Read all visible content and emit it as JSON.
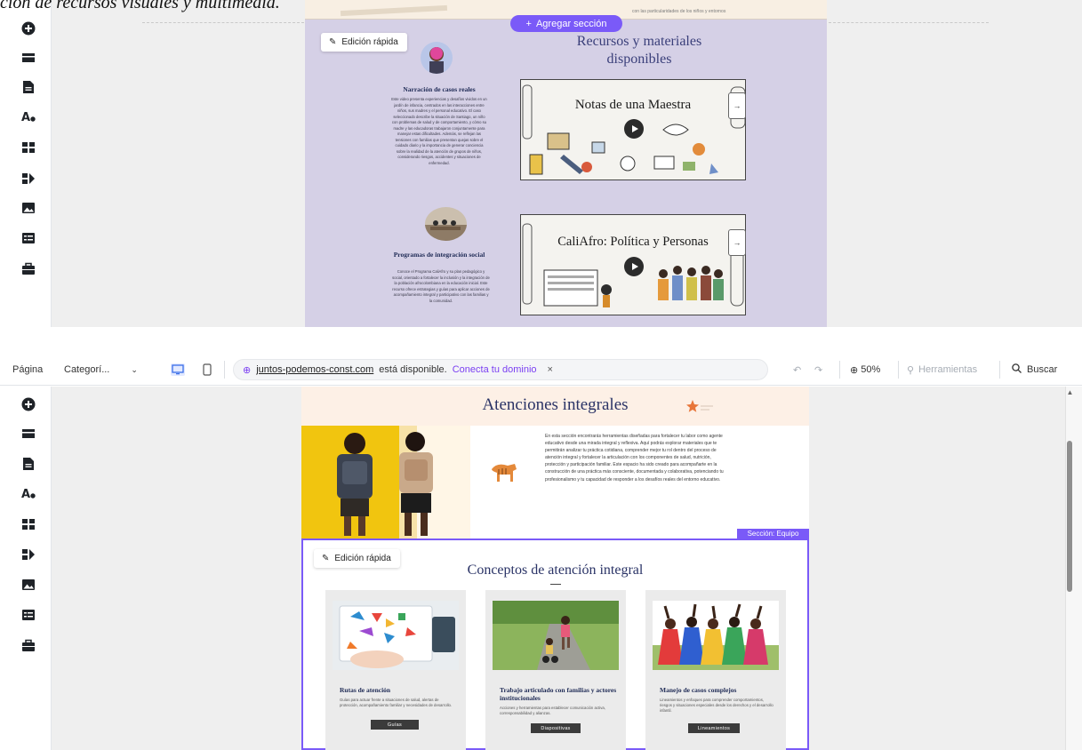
{
  "caption": "ción de recursos visuales y multimedia.",
  "sidebar": {
    "icons": [
      "add-icon",
      "sections-icon",
      "pages-icon",
      "theme-icon",
      "apps-icon",
      "business-apps-icon",
      "media-icon",
      "cms-icon",
      "portfolio-icon"
    ]
  },
  "top_view": {
    "strip_text": "con las particularidades de los niños y entornos",
    "add_section_label": "Agregar sección",
    "quick_edit_label": "Edición rápida",
    "resources_title": "Recursos y materiales disponibles",
    "columns": [
      {
        "title": "Narración de casos reales",
        "body": "Este video presenta experiencias y desafíos vividos en un jardín de infancia, centrados en las interacciones entre niños, sus madres y el personal educativo. El caso seleccionado describe la situación de Santiago, un niño con problemas de salud y de comportamiento, y cómo su madre y las educadoras trabajaron conjuntamente para manejar estas dificultades. Además, se reflejan las tensiones con familias que presentan quejas sobre el cuidado diario y la importancia de generar conciencia sobre la realidad de la atención de grupos de niños, considerando riesgos, accidentes y situaciones de enfermedad."
      },
      {
        "title": "Programas de integración social",
        "body": "Conoce el Programa CaliAfro y su plan pedagógico y social, orientado a fortalecer la inclusión y la integración de la población afrocolombiana en la educación inicial. Este recurso ofrece estrategias y guías para aplicar acciones de acompañamiento integral y participativo con las familias y la comunidad."
      }
    ],
    "videos": [
      {
        "title": "Notas de una Maestra"
      },
      {
        "title": "CaliAfro: Política y Personas"
      }
    ]
  },
  "toolbar": {
    "page_label": "Página",
    "page_value": "Categorí...",
    "domain": "juntos-podemos-const.com",
    "available_text": "está disponible.",
    "connect_label": "Conecta tu dominio",
    "close_label": "×",
    "zoom": "50%",
    "tools_label": "Herramientas",
    "search_label": "Buscar"
  },
  "bottom_view": {
    "hero_title": "Atenciones integrales",
    "hero_text": "En esta sección encontrarás herramientas diseñadas para fortalecer tu labor como agente educativo desde una mirada integral y reflexiva. Aquí podrás explorar materiales que te permitirán analizar tu práctica cotidiana, comprender mejor tu rol dentro del proceso de atención integral y fortalecer la articulación con los componentes de salud, nutrición, protección y participación familiar. Este espacio ha sido creado para acompañarte en la construcción de una práctica más consciente, documentada y colaborativa, potenciando tu profesionalismo y tu capacidad de responder a los desafíos reales del entorno educativo.",
    "section_badge": "Sección: Equipo",
    "quick_edit_label": "Edición rápida",
    "concepts_title": "Conceptos de atención integral",
    "cards": [
      {
        "title": "Rutas de atención",
        "body": "Guías para actuar frente a situaciones de salud, alertas de protección, acompañamiento familiar y necesidades de desarrollo.",
        "button": "Guías"
      },
      {
        "title": "Trabajo articulado con familias y actores institucionales",
        "body": "Acciones y herramientas para establecer comunicación activa, corresponsabilidad y alianzas.",
        "button": "Diapositivas"
      },
      {
        "title": "Manejo de casos complejos",
        "body": "Lineamientos y enfoques para comprender comportamientos, riesgos y situaciones especiales desde los derechos y el desarrollo infantil.",
        "button": "Lineamientos"
      }
    ]
  },
  "colors": {
    "accent": "#7a5af8",
    "lavender": "#d5d0e6",
    "peach": "#fdf0e6",
    "navy_text": "#2a3366"
  }
}
